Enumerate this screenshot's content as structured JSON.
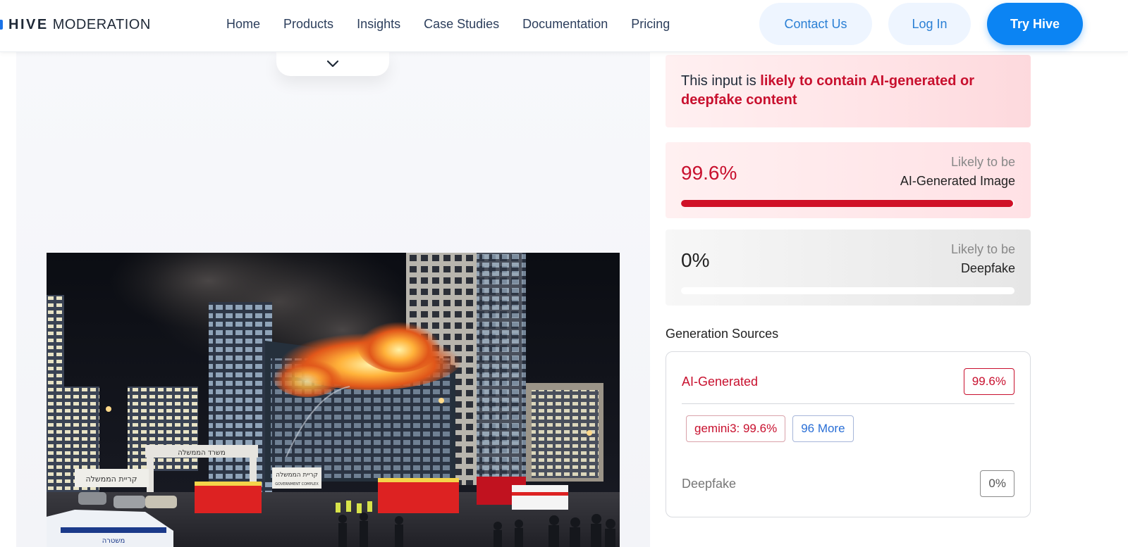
{
  "header": {
    "logo_bold": "HIVE",
    "logo_light": "MODERATION",
    "nav": [
      "Home",
      "Products",
      "Insights",
      "Case Studies",
      "Documentation",
      "Pricing"
    ],
    "contact_label": "Contact Us",
    "login_label": "Log In",
    "try_label": "Try Hive"
  },
  "result": {
    "verdict_prefix": "This input is ",
    "verdict_highlight": "likely to contain AI-generated or deepfake content",
    "ai": {
      "percent": "99.6%",
      "likely": "Likely to be",
      "label": "AI-Generated Image",
      "fill": 0.996
    },
    "deepfake": {
      "percent": "0%",
      "likely": "Likely to be",
      "label": "Deepfake",
      "fill": 0
    }
  },
  "generation_sources": {
    "title": "Generation Sources",
    "ai_label": "AI-Generated",
    "ai_percent": "99.6%",
    "chips": [
      "gemini3: 99.6%",
      "96 More"
    ],
    "deepfake_label": "Deepfake",
    "deepfake_percent": "0%"
  },
  "image_signs": {
    "sign1": "משרד הממשלה",
    "sign2": "קריית הממשלה",
    "sign3": "קריית הממשלה",
    "sign3_en": "GOVERNMENT COMPLEX",
    "police_text": "משטרה"
  },
  "colors": {
    "accent_red": "#c8102e",
    "brand_blue": "#0b84f3",
    "link_blue": "#2a7fd4"
  }
}
